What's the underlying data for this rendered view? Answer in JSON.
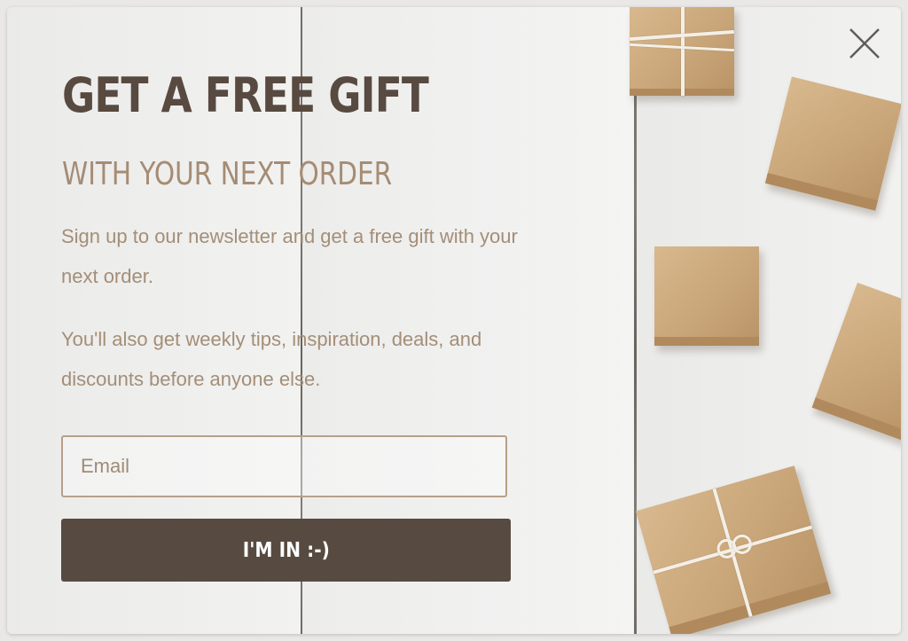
{
  "popup": {
    "headline": "GET A FREE GIFT",
    "subheadline": "WITH YOUR NEXT ORDER",
    "paragraph_1": "Sign up to our newsletter and get a free gift with your next order.",
    "paragraph_2": "You'll also get weekly tips, inspiration, deals, and discounts before anyone else.",
    "email_placeholder": "Email",
    "email_value": "",
    "submit_label": "I'M IN :-)",
    "close_icon": "close-icon"
  },
  "colors": {
    "headline": "#584a40",
    "subheadline": "#a58c74",
    "body_text": "#a48e77",
    "button_bg": "#574a40",
    "input_border": "#b6a08a"
  }
}
